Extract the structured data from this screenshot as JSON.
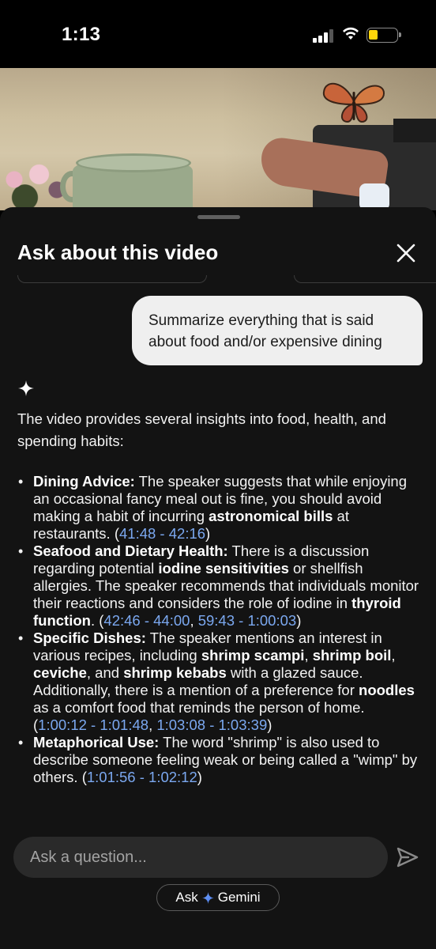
{
  "status_bar": {
    "time": "1:13",
    "battery_color": "#ffd60a"
  },
  "sheet": {
    "title": "Ask about this video",
    "user_message": "Summarize everything that is said about food and/or expensive dining",
    "answer": {
      "intro": "The video provides several insights into food, health, and spending habits:",
      "items": [
        {
          "heading": "Dining Advice:",
          "t1": " The speaker suggests that while enjoying an occasional fancy meal out is fine, you should avoid making a habit of incurring ",
          "b1": "astronomical bills",
          "t2": " at restaurants. (",
          "ts1": "41:48 - 42:16",
          "t3": ")"
        },
        {
          "heading": "Seafood and Dietary Health:",
          "t1": " There is a discussion regarding potential ",
          "b1": "iodine sensitivities",
          "t2": " or shellfish allergies. The speaker recommends that individuals monitor their reactions and considers the role of iodine in ",
          "b2": "thyroid function",
          "t3": ". (",
          "ts1": "42:46 - 44:00",
          "sep": ", ",
          "ts2": "59:43 - 1:00:03",
          "t4": ")"
        },
        {
          "heading": "Specific Dishes:",
          "t1": " The speaker mentions an interest in various recipes, including ",
          "b1": "shrimp scampi",
          "t2": ", ",
          "b2": "shrimp boil",
          "t3": ", ",
          "b3": "ceviche",
          "t4": ", and ",
          "b4": "shrimp kebabs",
          "t5": " with a glazed sauce. Additionally, there is a mention of a preference for ",
          "b5": "noodles",
          "t6": " as a comfort food that reminds the person of home. (",
          "ts1": "1:00:12 - 1:01:48",
          "sep": ", ",
          "ts2": "1:03:08 - 1:03:39",
          "t7": ")"
        },
        {
          "heading": "Metaphorical Use:",
          "t1": " The word \"shrimp\" is also used to describe someone feeling weak or being called a \"wimp\" by others. (",
          "ts1": "1:01:56 - 1:02:12",
          "t2": ")"
        }
      ]
    },
    "input_placeholder": "Ask a question...",
    "ask_gemini": {
      "pre": "Ask",
      "post": "Gemini"
    }
  },
  "icons": {
    "close": "close-icon",
    "send": "send-icon",
    "sparkle": "sparkle-icon",
    "gemini": "gemini-star-icon"
  },
  "colors": {
    "timestamp_link": "#7ba8f0",
    "sheet_bg": "#131313",
    "bubble_bg": "#efefef"
  }
}
